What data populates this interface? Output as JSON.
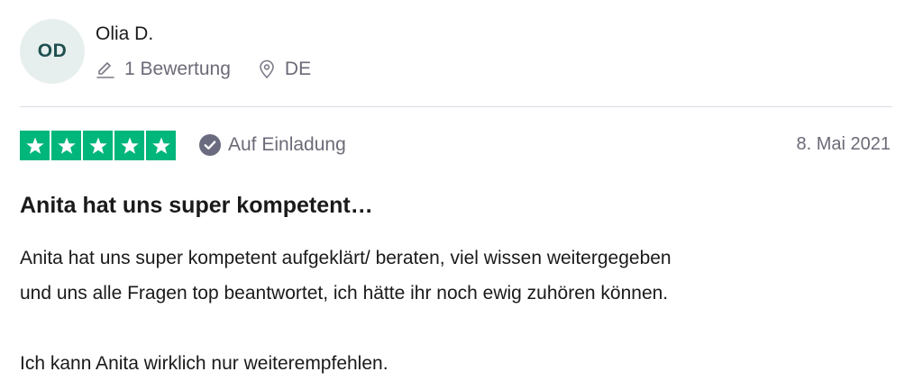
{
  "reviewer": {
    "initials": "OD",
    "name": "Olia D.",
    "review_count": "1 Bewertung",
    "country": "DE"
  },
  "rating": {
    "stars": 5,
    "max_stars": 5,
    "star_color": "#00b67a",
    "verified_label": "Auf Einladung"
  },
  "review": {
    "date": "8. Mai 2021",
    "title": "Anita hat uns super kompetent…",
    "text_line1": "Anita hat uns super kompetent aufgeklärt/ beraten, viel wissen weitergegeben",
    "text_line2": "und uns alle Fragen top beantwortet, ich hätte ihr noch ewig zuhören können.",
    "text_line3": "Ich kann Anita wirklich nur weiterempfehlen."
  },
  "icons": {
    "review_count": "pencil-icon",
    "location": "location-pin-icon",
    "verified": "checkmark-circle-icon",
    "star": "star-icon"
  }
}
